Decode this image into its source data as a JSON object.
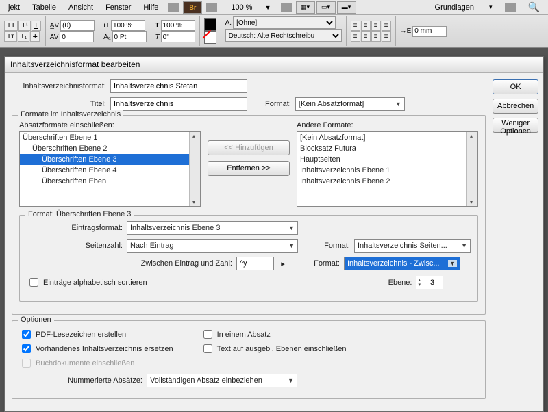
{
  "menubar": {
    "items": [
      "jekt",
      "Tabelle",
      "Ansicht",
      "Fenster",
      "Hilfe"
    ],
    "br": "Br",
    "zoom": "100 %",
    "workspace": "Grundlagen"
  },
  "toolbar": {
    "kern": "(0)",
    "track": "0",
    "scale1": "100 %",
    "scale2": "100 %",
    "baseline": "0 Pt",
    "skew": "0°",
    "charstyle": "[Ohne]",
    "lang": "Deutsch: Alte Rechtschreibu",
    "indent": "0 mm"
  },
  "dialog": {
    "title": "Inhaltsverzeichnisformat bearbeiten",
    "buttons": {
      "ok": "OK",
      "cancel": "Abbrechen",
      "less": "Weniger Optionen"
    },
    "toc_format_label": "Inhaltsverzeichnisformat:",
    "toc_format_value": "Inhaltsverzeichnis Stefan",
    "title_label": "Titel:",
    "title_value": "Inhaltsverzeichnis",
    "format_label": "Format:",
    "para_format": "[Kein Absatzformat]",
    "fs1_legend": "Formate im Inhaltsverzeichnis",
    "include_label": "Absatzformate einschließen:",
    "other_label": "Andere Formate:",
    "include_list": [
      {
        "t": "Überschriften Ebene 1",
        "ind": 0
      },
      {
        "t": "Überschriften Ebene 2",
        "ind": 1
      },
      {
        "t": "Überschriften Ebene 3",
        "ind": 2,
        "sel": true
      },
      {
        "t": "Überschriften Ebene 4",
        "ind": 2
      },
      {
        "t": "Überschriften Eben",
        "ind": 2
      }
    ],
    "other_list": [
      "[Kein Absatzformat]",
      "Blocksatz Futura",
      "Hauptseiten",
      "Inhaltsverzeichnis Ebene 1",
      "Inhaltsverzeichnis Ebene 2"
    ],
    "add": "<< Hinzufügen",
    "remove": "Entfernen >>",
    "fs2_legend": "Format: Überschriften Ebene 3",
    "entry_format_label": "Eintragsformat:",
    "entry_format": "Inhaltsverzeichnis Ebene 3",
    "page_num_label": "Seitenzahl:",
    "page_num": "Nach Eintrag",
    "page_fmt_label": "Format:",
    "page_fmt": "Inhaltsverzeichnis Seiten...",
    "between_label": "Zwischen Eintrag und Zahl:",
    "between": "^y",
    "between_fmt_label": "Format:",
    "between_fmt": "Inhaltsverzeichnis - Zwisc...",
    "sort": "Einträge alphabetisch sortieren",
    "level_label": "Ebene:",
    "level": "3",
    "fs3_legend": "Optionen",
    "pdf": "PDF-Lesezeichen erstellen",
    "one_para": "In einem Absatz",
    "replace": "Vorhandenes Inhaltsverzeichnis ersetzen",
    "hidden": "Text auf ausgebl. Ebenen einschließen",
    "book": "Buchdokumente einschließen",
    "numbered_label": "Nummerierte Absätze:",
    "numbered": "Vollständigen Absatz einbeziehen"
  }
}
